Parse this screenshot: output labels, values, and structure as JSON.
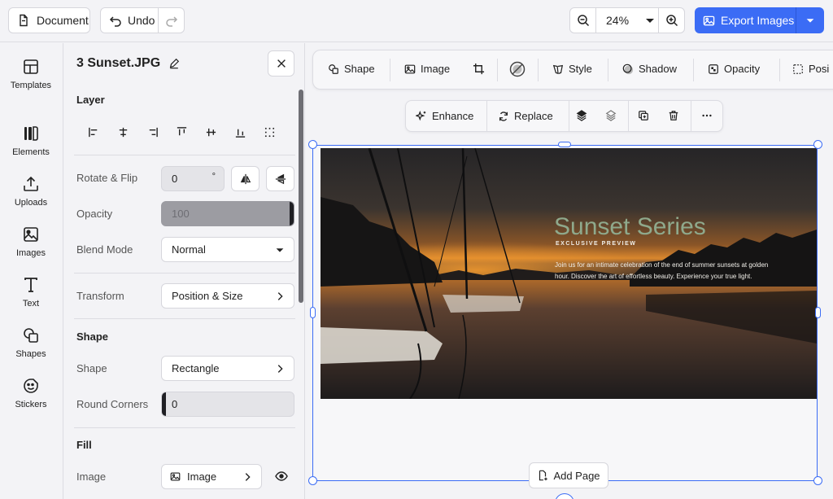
{
  "topbar": {
    "document_label": "Document",
    "undo_label": "Undo",
    "zoom_value": "24%",
    "export_label": "Export Images"
  },
  "sidebar": {
    "items": [
      {
        "label": "Templates",
        "icon": "templates-icon"
      },
      {
        "label": "Elements",
        "icon": "elements-icon"
      },
      {
        "label": "Uploads",
        "icon": "upload-icon"
      },
      {
        "label": "Images",
        "icon": "image-icon"
      },
      {
        "label": "Text",
        "icon": "text-icon"
      },
      {
        "label": "Shapes",
        "icon": "shapes-icon"
      },
      {
        "label": "Stickers",
        "icon": "sticker-icon"
      }
    ]
  },
  "panel": {
    "title": "3 Sunset.JPG",
    "layer": {
      "heading": "Layer",
      "rotate_label": "Rotate & Flip",
      "rotate_value": "0",
      "rotate_unit": "°",
      "opacity_label": "Opacity",
      "opacity_value": "100",
      "blend_label": "Blend Mode",
      "blend_value": "Normal",
      "transform_label": "Transform",
      "transform_value": "Position & Size"
    },
    "shape": {
      "heading": "Shape",
      "shape_label": "Shape",
      "shape_value": "Rectangle",
      "corners_label": "Round Corners",
      "corners_value": "0"
    },
    "fill": {
      "heading": "Fill",
      "image_label": "Image",
      "image_value": "Image"
    }
  },
  "toolbar": {
    "shape": "Shape",
    "image": "Image",
    "style": "Style",
    "shadow": "Shadow",
    "opacity": "Opacity",
    "position": "Posi"
  },
  "image_toolbar": {
    "enhance": "Enhance",
    "replace": "Replace"
  },
  "design": {
    "headline": "Sunset Series",
    "tagline": "EXCLUSIVE PREVIEW",
    "body_line1": "Join us for an intimate celebration of the end of summer sunsets at golden",
    "body_line2": "hour. Discover the art of effortless beauty. Experience your true light."
  },
  "canvas": {
    "add_page_label": "Add Page"
  },
  "colors": {
    "accent": "#3b6cf5",
    "headline": "#8fa98c"
  }
}
